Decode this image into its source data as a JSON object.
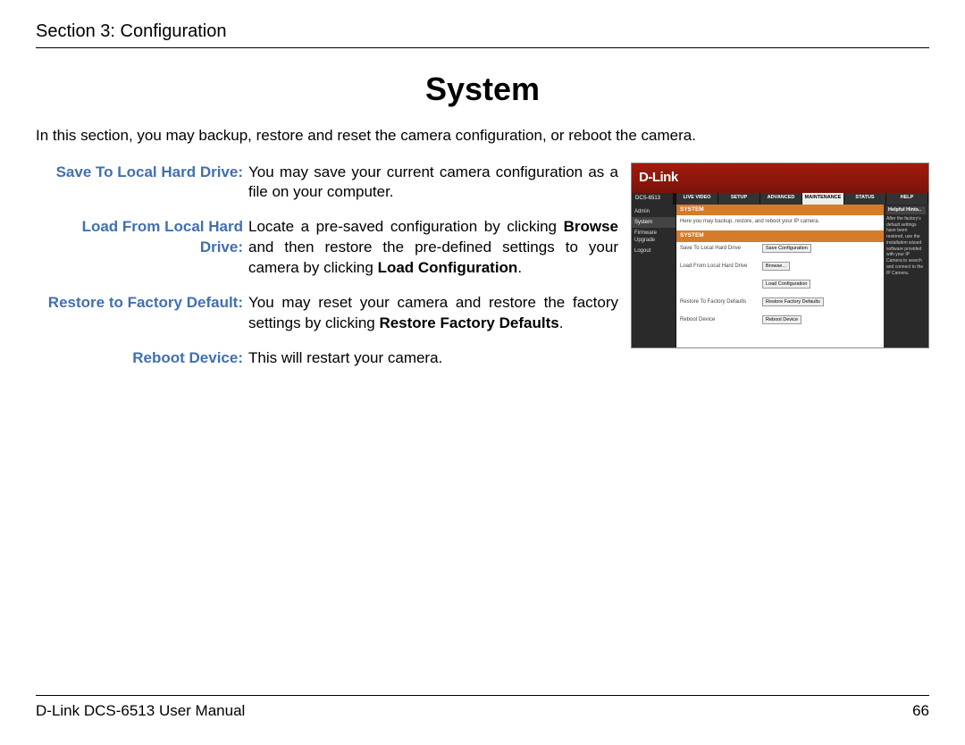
{
  "header": {
    "section": "Section 3: Configuration"
  },
  "title": "System",
  "intro": "In this section, you may backup, restore and reset the camera configuration, or reboot the camera.",
  "rows": [
    {
      "term": "Save To Local Hard Drive:",
      "desc_pre": "You may save your current camera configuration as a file on your computer.",
      "bold1": "",
      "mid": "",
      "bold2": "",
      "post": ""
    },
    {
      "term": "Load From Local Hard Drive:",
      "desc_pre": "Locate a pre-saved configuration by clicking ",
      "bold1": "Browse",
      "mid": " and then restore the pre-defined settings to your camera by clicking ",
      "bold2": "Load Configuration",
      "post": "."
    },
    {
      "term": "Restore to Factory Default:",
      "desc_pre": "You may reset your camera and restore the factory settings by clicking ",
      "bold1": "Restore Factory Defaults",
      "mid": "",
      "bold2": "",
      "post": "."
    },
    {
      "term": "Reboot Device:",
      "desc_pre": "This will restart your camera.",
      "bold1": "",
      "mid": "",
      "bold2": "",
      "post": ""
    }
  ],
  "screenshot": {
    "logo": "D-Link",
    "model": "DCS-6513",
    "tabs": [
      "LIVE VIDEO",
      "SETUP",
      "ADVANCED",
      "MAINTENANCE",
      "STATUS",
      "HELP"
    ],
    "active_tab_index": 3,
    "side": [
      "Admin",
      "System",
      "Firmware Upgrade",
      "Logout"
    ],
    "side_active_index": 1,
    "panel_head1": "SYSTEM",
    "panel_sub": "Here you may backup, restore, and reboot your IP camera.",
    "panel_head2": "SYSTEM",
    "form": [
      {
        "label": "Save To Local Hard Drive",
        "button": "Save Configuration"
      },
      {
        "label": "Load From Local Hard Drive",
        "button": "Browse..."
      },
      {
        "label": "",
        "button": "Load Configuration"
      },
      {
        "label": "Restore To Factory Defaults",
        "button": "Restore Factory Defaults"
      },
      {
        "label": "Reboot Device",
        "button": "Reboot Device"
      }
    ],
    "hints_head": "Helpful Hints..",
    "hints_body": "After the factory's default settings have been restored, use the installation wizard software provided with your IP Camera to search and connect to the IP Camera."
  },
  "footer": {
    "left": "D-Link DCS-6513 User Manual",
    "page": "66"
  }
}
